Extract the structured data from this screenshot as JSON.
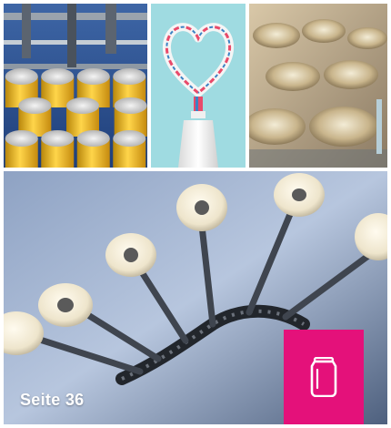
{
  "photos": {
    "cans_line": {
      "icon": "beverage-cans-photo"
    },
    "toothpaste": {
      "icon": "toothpaste-heart-photo"
    },
    "tins": {
      "icon": "metal-tins-photo"
    },
    "conveyor": {
      "icon": "conveyor-chain-photo"
    }
  },
  "caption": {
    "text": "Seite 36"
  },
  "badge": {
    "icon": "can-icon",
    "color": "#e4117a"
  }
}
